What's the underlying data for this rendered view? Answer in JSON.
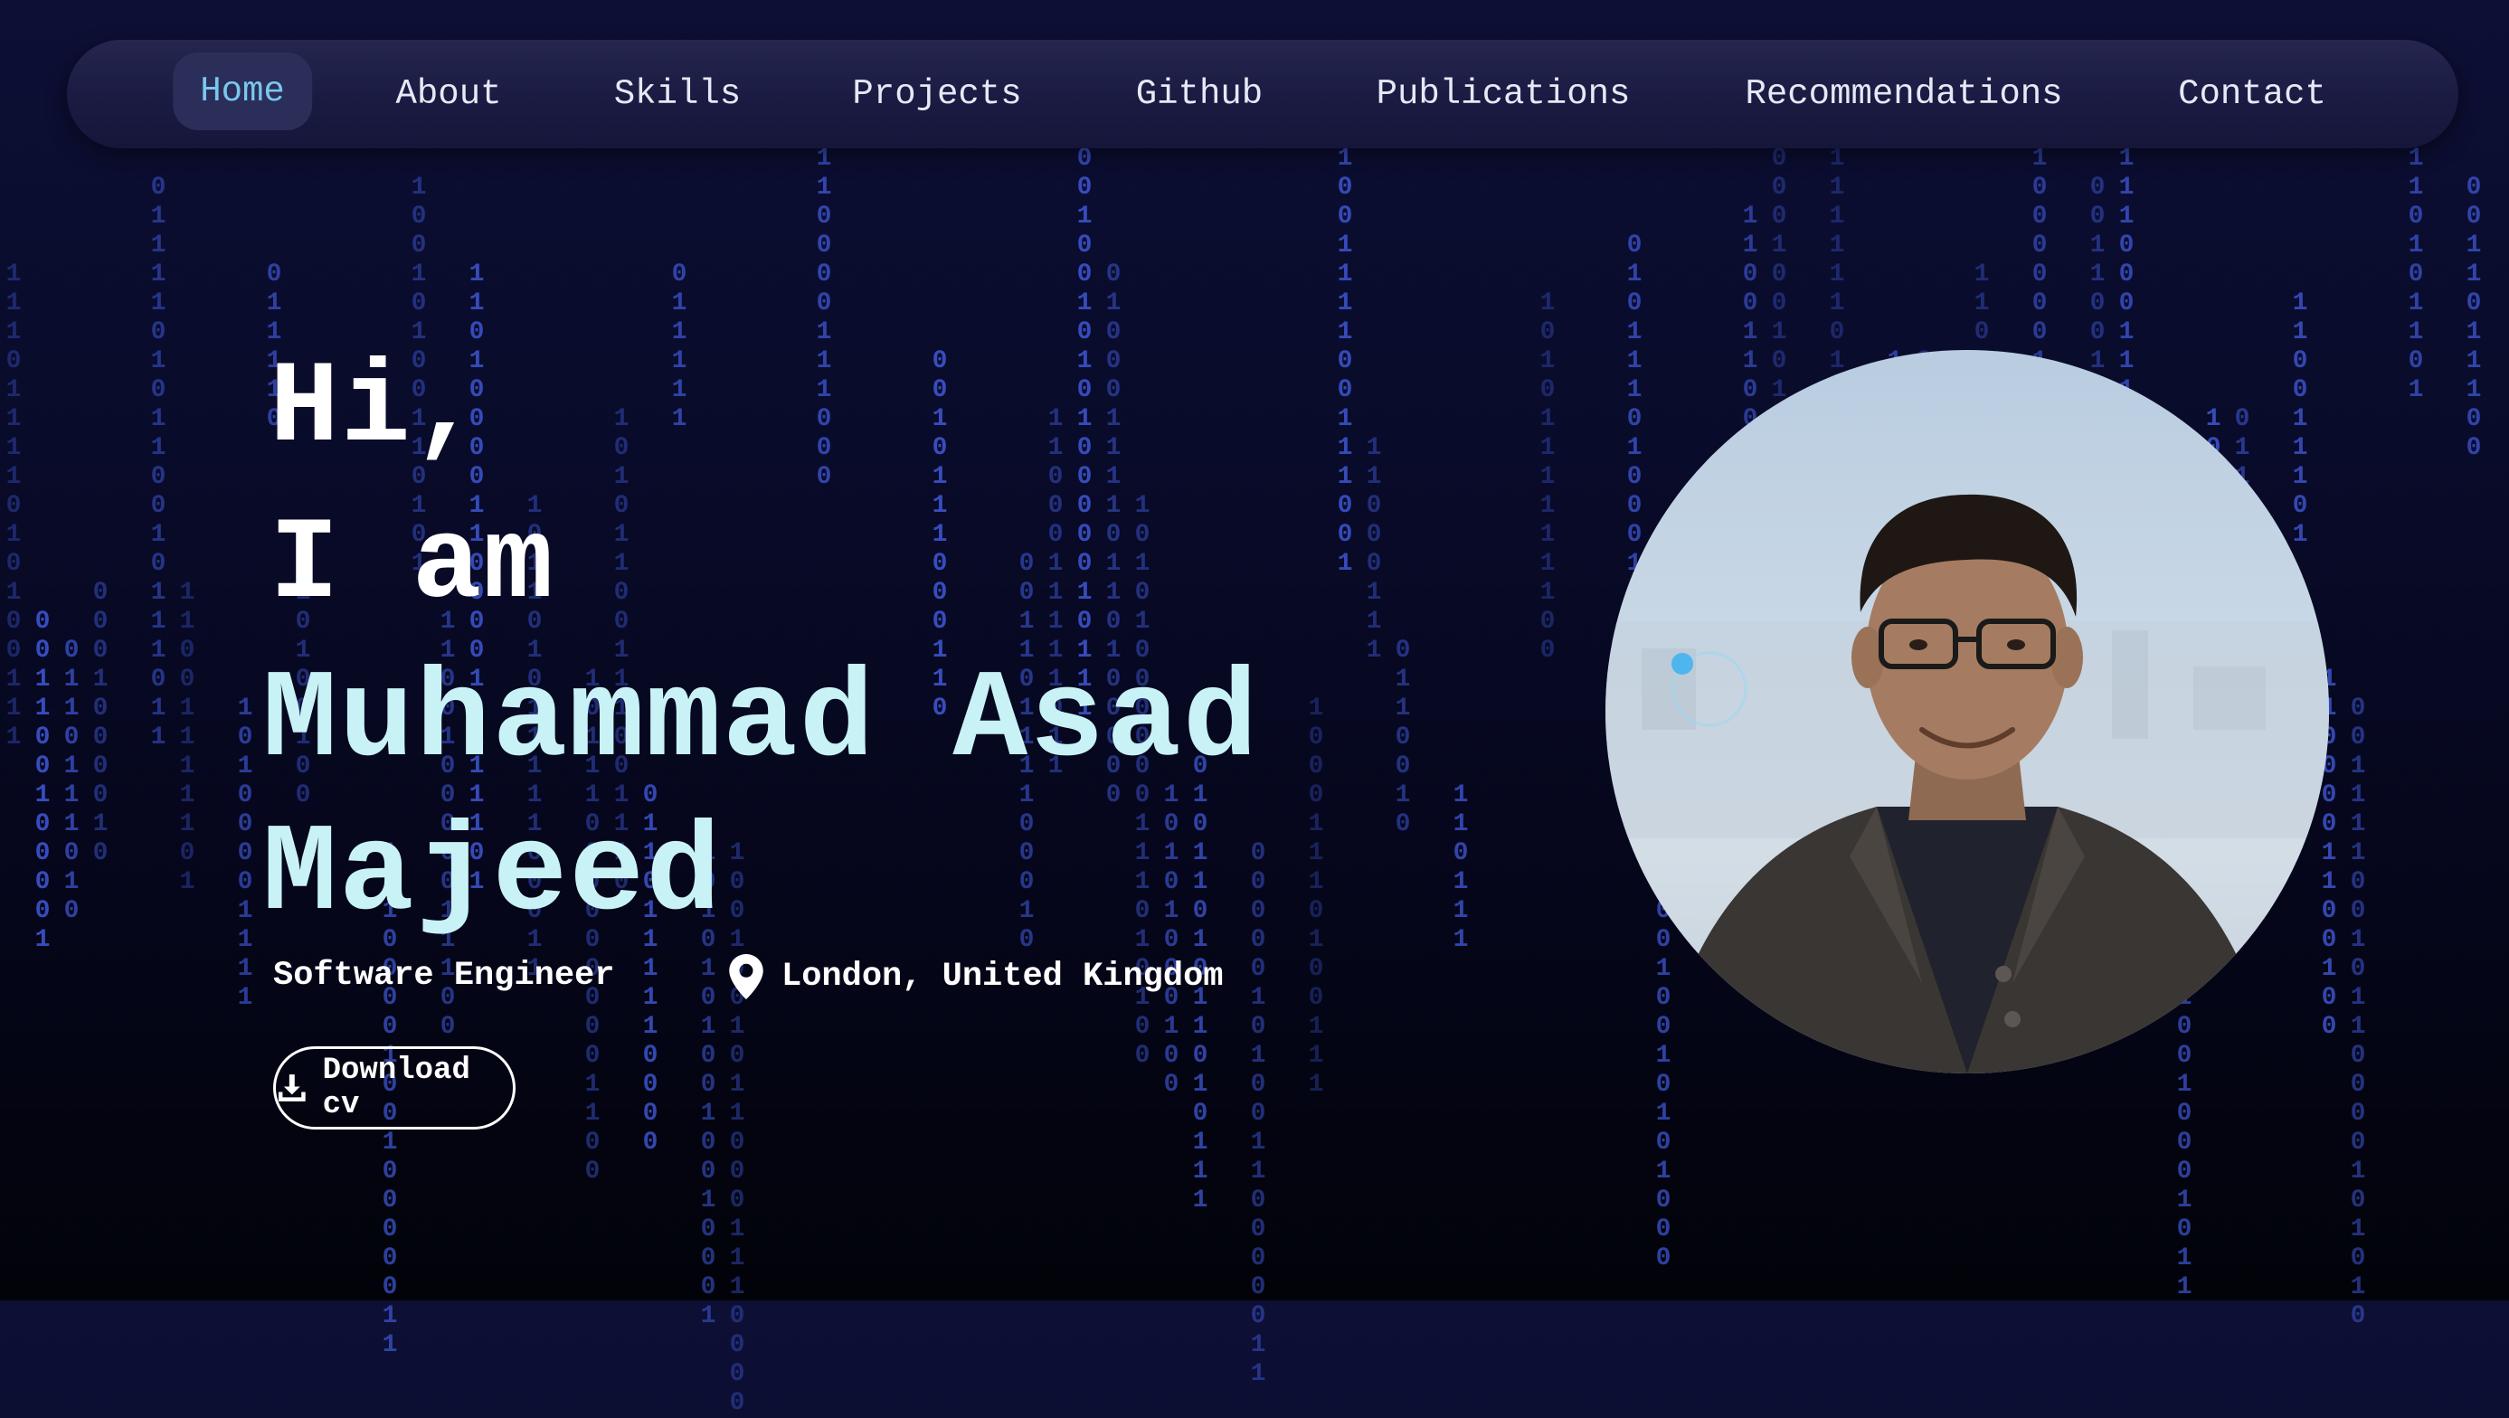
{
  "nav": {
    "items": [
      {
        "label": "Home",
        "active": true
      },
      {
        "label": "About"
      },
      {
        "label": "Skills"
      },
      {
        "label": "Projects"
      },
      {
        "label": "Github"
      },
      {
        "label": "Publications"
      },
      {
        "label": "Recommendations"
      },
      {
        "label": "Contact"
      }
    ]
  },
  "hero": {
    "greeting": "Hi,",
    "intro": "I am",
    "name_line1": "Muhammad Asad",
    "name_line2": "Majeed",
    "title": "Software Engineer",
    "location": "London, United Kingdom",
    "download_label": "Download cv",
    "location_icon": "map-pin-icon",
    "download_icon": "download-icon"
  },
  "colors": {
    "background": "#090b2a",
    "rain": "#3b52c9",
    "accent_name": "#c8f2f6",
    "nav_active": "#79c8ee",
    "text": "#ffffff"
  }
}
